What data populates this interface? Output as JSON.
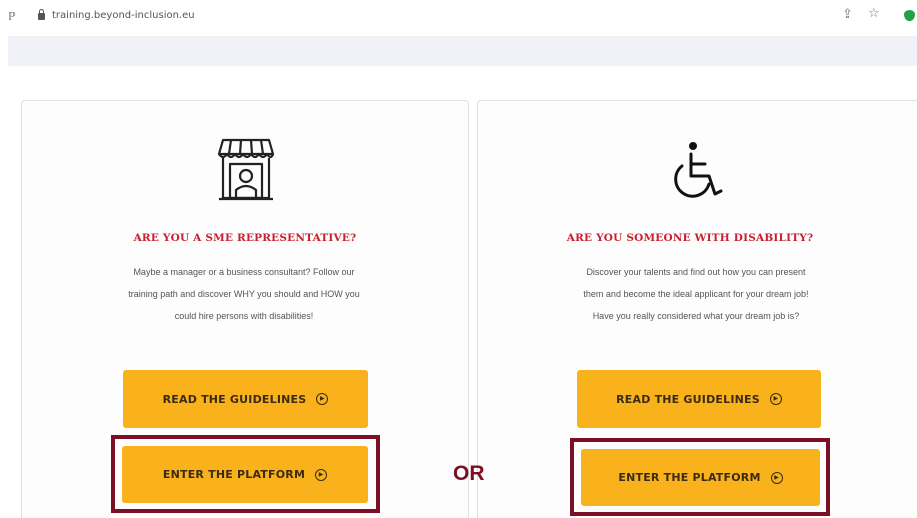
{
  "browser": {
    "tab_glyph": "ℙ",
    "url": "training.beyond-inclusion.eu",
    "share_glyph": "⇪",
    "star_glyph": "☆"
  },
  "cards": {
    "sme": {
      "icon": "shop-icon",
      "title": "ARE YOU A SME REPRESENTATIVE?",
      "lines": [
        "Maybe a manager or a business consultant? Follow our",
        "training path and discover WHY you should and HOW you",
        "could hire persons with disabilities!"
      ],
      "guidelines_label": "READ THE GUIDELINES",
      "enter_label": "ENTER THE PLATFORM"
    },
    "disability": {
      "icon": "wheelchair-icon",
      "title": "ARE YOU SOMEONE WITH DISABILITY?",
      "lines": [
        "Discover your talents and find out how you can present",
        "them and become the ideal applicant for your dream job!",
        "Have you really considered what your dream job is?"
      ],
      "guidelines_label": "READ THE GUIDELINES",
      "enter_label": "ENTER THE PLATFORM"
    }
  },
  "or_label": "OR",
  "colors": {
    "title_red": "#c8202f",
    "button_yellow": "#f9b21b",
    "highlight_maroon": "#7b1024"
  }
}
